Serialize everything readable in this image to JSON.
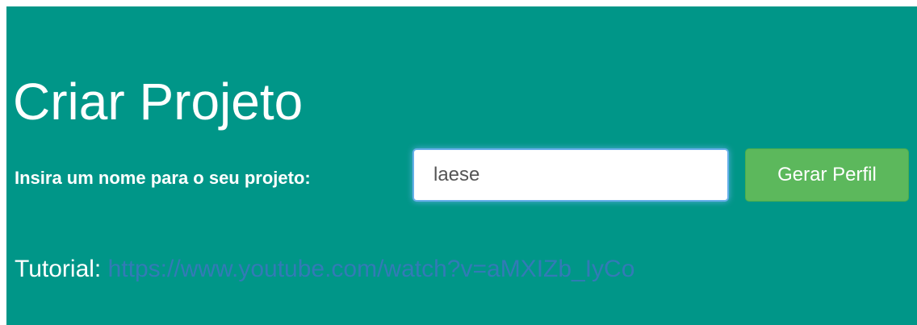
{
  "page": {
    "title": "Criar Projeto"
  },
  "form": {
    "label": "Insira um nome para o seu projeto:",
    "input_value": "laese",
    "button_label": "Gerar Perfil"
  },
  "tutorial": {
    "label": "Tutorial:",
    "link_text": "https://www.youtube.com/watch?v=aMXIZb_IyCo"
  },
  "colors": {
    "background": "#009688",
    "button": "#5cb85c",
    "link": "#337ab7",
    "input_focus": "#66afe9"
  }
}
